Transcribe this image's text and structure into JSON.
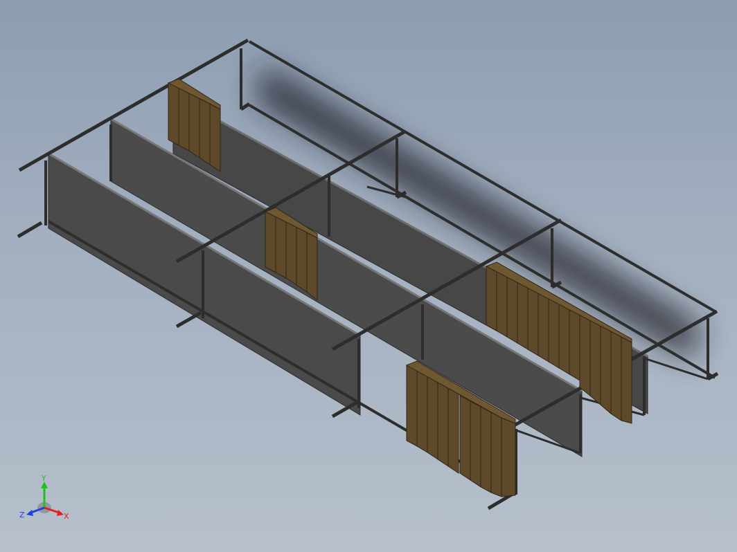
{
  "viewport": {
    "background_top": "#8d9db1",
    "background_bottom": "#b7c0cc"
  },
  "model": {
    "frame_color": "#3a3a3a",
    "wall_color": "#4a4a4a",
    "pallet_color": "#5e4a2a",
    "pallet_dark": "#2f2414",
    "shadow_color": "#20242b"
  },
  "triad": {
    "y_label": "Y",
    "x_label": "X",
    "z_label": "Z",
    "y_color": "#20c020",
    "x_color": "#e02020",
    "z_color": "#2040e0"
  }
}
